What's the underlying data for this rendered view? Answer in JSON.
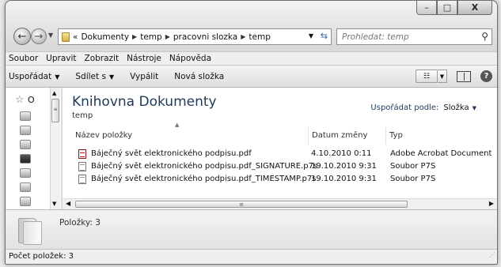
{
  "window": {
    "minimize_glyph": "–",
    "maximize_glyph": "□",
    "close_glyph": "X"
  },
  "address": {
    "prefix": "«",
    "crumbs": [
      "Dokumenty",
      "temp",
      "pracovni slozka",
      "temp"
    ]
  },
  "search": {
    "placeholder": "Prohledat: temp"
  },
  "menu": {
    "items": [
      "Soubor",
      "Upravit",
      "Zobrazit",
      "Nástroje",
      "Nápověda"
    ]
  },
  "commands": {
    "organize": "Uspořádat",
    "share": "Sdílet s",
    "burn": "Vypálit",
    "new_folder": "Nová složka"
  },
  "nav_pane": {
    "label": "O"
  },
  "library": {
    "title": "Knihovna Dokumenty",
    "subtitle": "temp",
    "arrange_label": "Uspořádat podle:",
    "arrange_value": "Složka"
  },
  "columns": {
    "name": "Název položky",
    "date": "Datum změny",
    "type": "Typ"
  },
  "files": [
    {
      "name": "Báječný svět elektronického podpisu.pdf",
      "date": "4.10.2010 0:11",
      "type": "Adobe Acrobat Document",
      "icon": "pdf"
    },
    {
      "name": "Báječný svět elektronického podpisu.pdf_SIGNATURE.p7s",
      "date": "19.10.2010 9:31",
      "type": "Soubor P7S",
      "icon": "p7s"
    },
    {
      "name": "Báječný svět elektronického podpisu.pdf_TIMESTAMP.p7s",
      "date": "19.10.2010 9:31",
      "type": "Soubor P7S",
      "icon": "p7s"
    }
  ],
  "details": {
    "count_text": "Položky: 3"
  },
  "status": {
    "text": "Počet položek: 3"
  }
}
